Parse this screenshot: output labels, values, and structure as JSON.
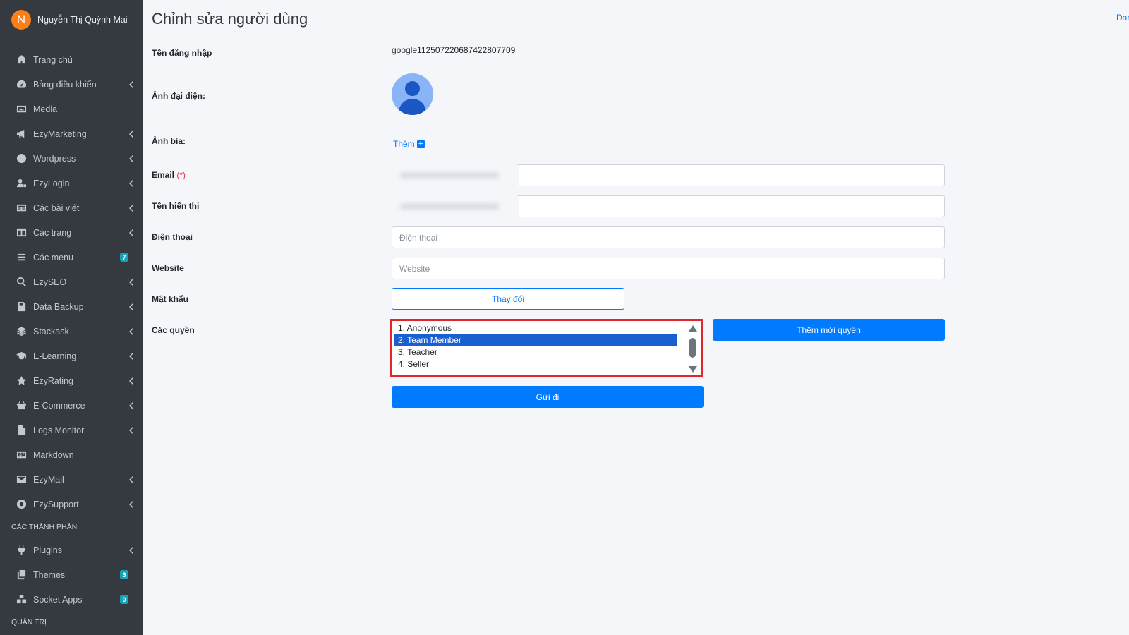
{
  "sidebar": {
    "user_initial": "N",
    "user_name": "Nguyễn Thị Quỳnh Mai",
    "items": [
      {
        "label": "Trang chủ",
        "icon": "home-icon",
        "chevron": false
      },
      {
        "label": "Bảng điều khiển",
        "icon": "dashboard-icon",
        "chevron": true
      },
      {
        "label": "Media",
        "icon": "image-icon",
        "chevron": false
      },
      {
        "label": "EzyMarketing",
        "icon": "megaphone-icon",
        "chevron": true
      },
      {
        "label": "Wordpress",
        "icon": "wordpress-icon",
        "chevron": true
      },
      {
        "label": "EzyLogin",
        "icon": "user-lock-icon",
        "chevron": true
      },
      {
        "label": "Các bài viết",
        "icon": "newspaper-icon",
        "chevron": true
      },
      {
        "label": "Các trang",
        "icon": "columns-icon",
        "chevron": true
      },
      {
        "label": "Các menu",
        "icon": "bars-icon",
        "badge": "7"
      },
      {
        "label": "EzySEO",
        "icon": "search-icon",
        "chevron": true
      },
      {
        "label": "Data Backup",
        "icon": "backup-icon",
        "chevron": true
      },
      {
        "label": "Stackask",
        "icon": "layers-icon",
        "chevron": true
      },
      {
        "label": "E-Learning",
        "icon": "graduation-cap-icon",
        "chevron": true
      },
      {
        "label": "EzyRating",
        "icon": "star-icon",
        "chevron": true
      },
      {
        "label": "E-Commerce",
        "icon": "basket-icon",
        "chevron": true
      },
      {
        "label": "Logs Monitor",
        "icon": "file-log-icon",
        "chevron": true
      },
      {
        "label": "Markdown",
        "icon": "markdown-icon",
        "chevron": false
      },
      {
        "label": "EzyMail",
        "icon": "envelope-icon",
        "chevron": true
      },
      {
        "label": "EzySupport",
        "icon": "lifebuoy-icon",
        "chevron": true
      }
    ],
    "section_components": "CÁC THÀNH PHẦN",
    "component_items": [
      {
        "label": "Plugins",
        "icon": "plug-icon",
        "chevron": true
      },
      {
        "label": "Themes",
        "icon": "copy-icon",
        "badge": "3"
      },
      {
        "label": "Socket Apps",
        "icon": "cubes-icon",
        "badge": "0"
      }
    ],
    "section_admin": "QUẢN TRỊ"
  },
  "main": {
    "title": "Chỉnh sửa người dùng",
    "top_link": "Danh sách",
    "labels": {
      "username": "Tên đăng nhập",
      "avatar": "Ảnh đại diện:",
      "cover": "Ảnh bìa:",
      "email": "Email",
      "required_mark": "(*)",
      "display_name": "Tên hiển thị",
      "phone": "Điện thoại",
      "website": "Website",
      "password": "Mật khẩu",
      "roles": "Các quyền"
    },
    "username_value": "google112507220687422807709",
    "cover_add": "Thêm",
    "phone_placeholder": "Điện thoại",
    "website_placeholder": "Website",
    "change_password_button": "Thay đổi",
    "roles_options": [
      "1. Anonymous",
      "2. Team Member",
      "3. Teacher",
      "4. Seller"
    ],
    "roles_selected_index": 1,
    "add_role_button": "Thêm mới quyền",
    "submit_button": "Gửi đi"
  },
  "colors": {
    "sidebar_bg": "#343a40",
    "primary": "#007bff",
    "highlight_border": "#e0262c",
    "badge": "#17a2b8",
    "avatar_bg": "#fd7e14"
  }
}
